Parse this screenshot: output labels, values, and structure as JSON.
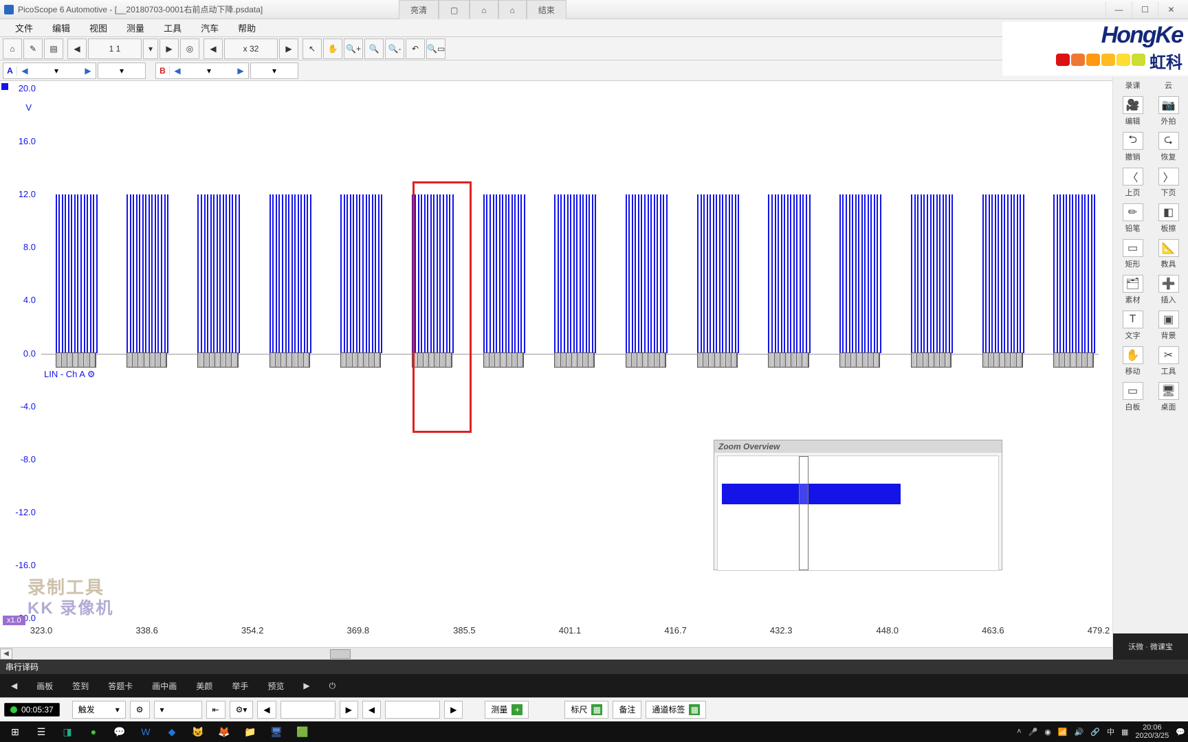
{
  "window": {
    "title": "PicoScope 6 Automotive - [__20180703-0001右前点动下降.psdata]",
    "top_tabs": [
      "亮清",
      "▢",
      "⌂",
      "⌂",
      "结束"
    ],
    "min": "—",
    "max": "☐",
    "close": "✕"
  },
  "menu": [
    "文件",
    "编辑",
    "视图",
    "测量",
    "工具",
    "汽车",
    "帮助"
  ],
  "toolbar": {
    "home": "⌂",
    "wand": "✎",
    "doc": "▤",
    "nav_prev": "◀",
    "nav_value": "1 1",
    "nav_next": "▶",
    "target": "◎",
    "zoom_prev": "◀",
    "zoom_label": "x 32",
    "zoom_next": "▶",
    "pointer": "↖",
    "hand": "✋",
    "zin": "🔍+",
    "zfull": "🔍",
    "zout": "🔍-",
    "undo": "↶",
    "zmode": "🔍▭"
  },
  "channels": {
    "A": {
      "label": "A",
      "arrow_l": "◀",
      "value": "",
      "arrow_r": "▶",
      "dd": "▾"
    },
    "B": {
      "label": "B",
      "arrow_l": "◀",
      "value": "",
      "arrow_r": "▶",
      "dd": "▾"
    },
    "extra": "▾"
  },
  "chart_data": {
    "type": "line",
    "title": "",
    "ylabel": "V",
    "ylim": [
      -20,
      20
    ],
    "yticks": [
      -20.0,
      -16.0,
      -12.0,
      -8.0,
      -4.0,
      0.0,
      4.0,
      8.0,
      12.0,
      16.0,
      20.0
    ],
    "xlim": [
      323.0,
      479.2
    ],
    "xticks": [
      323.0,
      338.6,
      354.2,
      369.8,
      385.5,
      401.1,
      416.7,
      432.3,
      448.0,
      463.6,
      479.2
    ],
    "series": [
      {
        "name": "LIN - Ch A",
        "color": "#1414e8",
        "high": 12.0,
        "low": 0.0
      }
    ],
    "burst_centers_x": [
      328.1,
      338.6,
      349.1,
      359.7,
      370.2,
      380.7,
      391.3,
      401.8,
      412.3,
      422.9,
      433.4,
      443.9,
      454.5,
      465.0,
      475.5
    ],
    "burst_width_x": 6.0,
    "highlight": {
      "x0": 377.8,
      "x1": 386.6,
      "y0": -6.0,
      "y1": 13.0
    }
  },
  "zoom_overview": {
    "title": "Zoom Overview"
  },
  "channel_label": "LIN - Ch A",
  "bottom_dock_title": "串行译码",
  "recorder_tabs": [
    "画板",
    "签到",
    "答题卡",
    "画中画",
    "美颜",
    "举手",
    "预览",
    "▶",
    "⏻"
  ],
  "recorder_time": "00:05:37",
  "bottom_tb": {
    "trigger": "触发",
    "trig_dd": "▾",
    "cfg": "⚙",
    "arr_l": "◀",
    "arr_r": "▶",
    "arr_l2": "◀",
    "arr_r2": "▶",
    "measure": "测量",
    "ruler": "标尺",
    "note": "备注",
    "chlabel": "通道标签"
  },
  "taskbar": {
    "left_icons": [
      "⊞",
      "☰",
      "◨",
      "●",
      "💬",
      "W",
      "◆",
      "😺",
      "🦊",
      "📁",
      "🖥",
      "🟩"
    ],
    "right": {
      "ime": "中",
      "net": "▦",
      "time": "20:06",
      "date": "2020/3/25"
    }
  },
  "brand": {
    "name": "HongKe",
    "cn": "虹科"
  },
  "right_panel": {
    "row0": [
      "录课",
      "云"
    ],
    "rows": [
      [
        "编辑",
        "外拍"
      ],
      [
        "撤销",
        "恢复"
      ],
      [
        "上页",
        "下页"
      ],
      [
        "铅笔",
        "板擦"
      ],
      [
        "矩形",
        "教具"
      ],
      [
        "素材",
        "插入"
      ],
      [
        "文字",
        "背景"
      ],
      [
        "移动",
        "工具"
      ],
      [
        "白板",
        "桌面"
      ]
    ],
    "footer": "沃微 · 微课宝"
  },
  "watermark1": "录制工具",
  "watermark2": "KK 录像机",
  "chip": "x1.0"
}
